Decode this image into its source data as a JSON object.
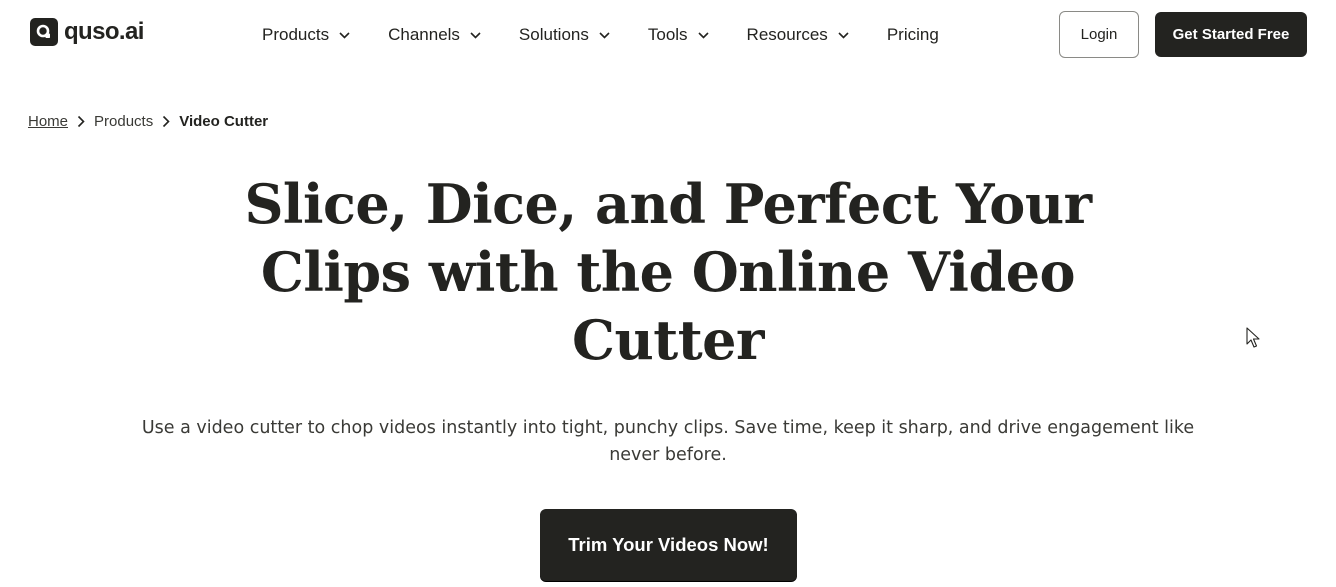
{
  "brand": {
    "name": "quso.ai",
    "colors": {
      "primary": "#232320",
      "background": "#ffffff",
      "text_muted": "#3a3a36"
    }
  },
  "header": {
    "nav": [
      {
        "label": "Products",
        "icon": "chevron-down-icon"
      },
      {
        "label": "Channels",
        "icon": "chevron-down-icon"
      },
      {
        "label": "Solutions",
        "icon": "chevron-down-icon"
      },
      {
        "label": "Tools",
        "icon": "chevron-down-icon"
      },
      {
        "label": "Resources",
        "icon": "chevron-down-icon"
      },
      {
        "label": "Pricing"
      }
    ],
    "login_label": "Login",
    "cta_label": "Get Started Free"
  },
  "breadcrumb": {
    "items": [
      "Home",
      "Products",
      "Video Cutter"
    ],
    "separator_icon": "chevron-right-icon"
  },
  "hero": {
    "title": "Slice, Dice, and Perfect Your Clips with the Online Video Cutter",
    "subtitle": "Use a video cutter to chop videos instantly into tight, punchy clips. Save time, keep it sharp, and drive engagement like never before.",
    "cta_label": "Trim Your Videos Now!"
  },
  "icons": {
    "logo": "quso-logo-icon",
    "cursor": "mouse-pointer-icon"
  }
}
